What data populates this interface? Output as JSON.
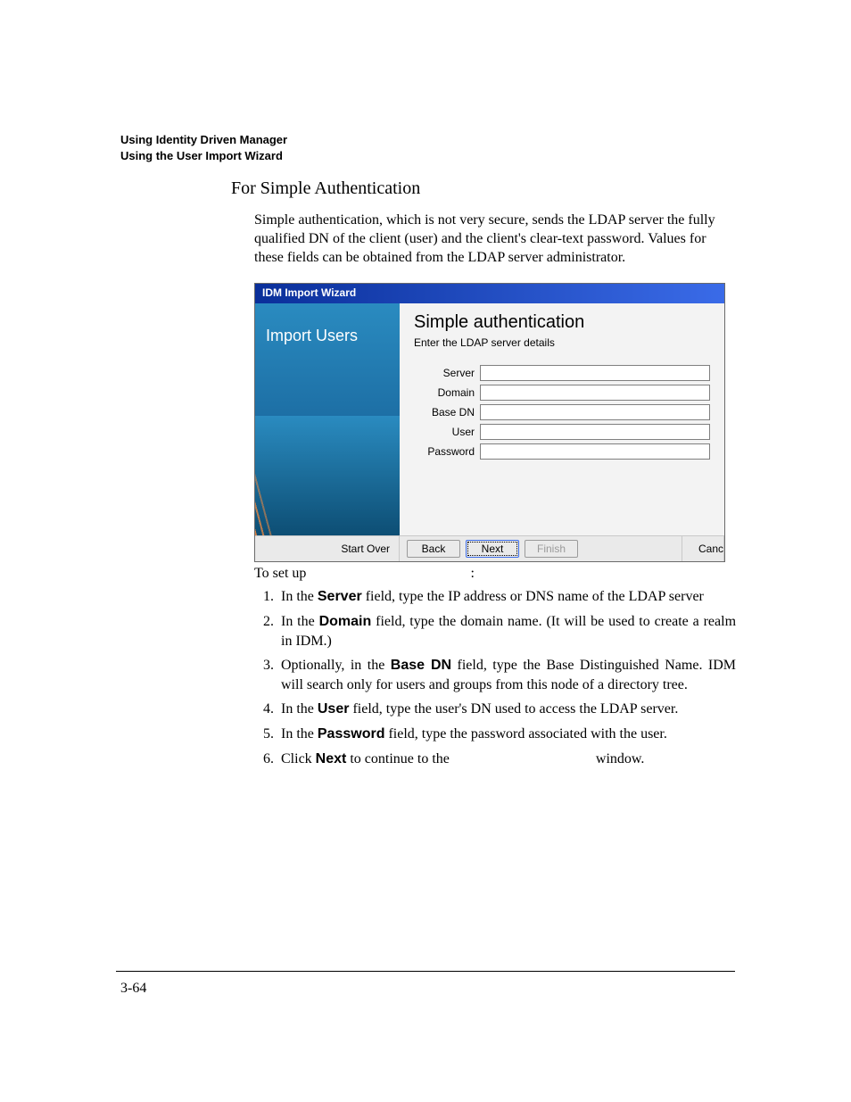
{
  "running_head": {
    "line1": "Using Identity Driven Manager",
    "line2": "Using the User Import Wizard"
  },
  "section": {
    "heading": "For Simple Authentication",
    "intro": "Simple authentication, which is not very secure, sends the LDAP server the fully qualified DN of the client (user) and the client's clear-text password. Values for these fields can be obtained from the LDAP server administrator."
  },
  "wizard": {
    "title": "IDM Import Wizard",
    "side_title": "Import Users",
    "main_heading": "Simple authentication",
    "main_sub": "Enter the LDAP server details",
    "fields": {
      "server": {
        "label": "Server",
        "value": ""
      },
      "domain": {
        "label": "Domain",
        "value": ""
      },
      "basedn": {
        "label": "Base DN",
        "value": ""
      },
      "user": {
        "label": "User",
        "value": ""
      },
      "password": {
        "label": "Password",
        "value": ""
      }
    },
    "footer": {
      "start_over": "Start Over",
      "back": "Back",
      "next": "Next",
      "finish": "Finish",
      "cancel_truncated": "Canc"
    }
  },
  "caption": {
    "setup_prefix": "To set up ",
    "colon": ":"
  },
  "steps": {
    "s1a": "In the ",
    "s1b": "Server",
    "s1c": " field, type the IP address or DNS name of the LDAP server",
    "s2a": "In the ",
    "s2b": "Domain",
    "s2c": " field, type the domain name. (It will be used to create a realm in IDM.)",
    "s3a": "Optionally, in the ",
    "s3b": "Base DN",
    "s3c": " field, type the Base Distinguished Name. IDM will search only for users and groups from this node of a directory tree.",
    "s4a": "In the ",
    "s4b": "User",
    "s4c": " field, type the user's DN used to access the LDAP server.",
    "s5a": "In the ",
    "s5b": "Password",
    "s5c": " field, type the password associated with the user.",
    "s6a": "Click ",
    "s6b": "Next",
    "s6c": " to continue to the ",
    "s6d": " window."
  },
  "page_number": "3-64"
}
